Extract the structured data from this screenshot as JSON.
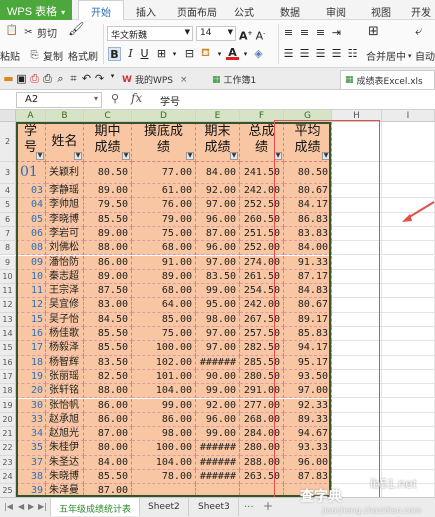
{
  "app": {
    "title": "WPS 表格"
  },
  "menu": [
    "开始",
    "插入",
    "页面布局",
    "公式",
    "数据",
    "审阅",
    "视图",
    "开发工"
  ],
  "ribbon": {
    "paste": "粘贴",
    "cut": "剪切",
    "copy": "复制",
    "format_painter": "格式刷",
    "font_name": "华文新魏",
    "font_size": "14",
    "merge_center": "合并居中",
    "auto": "自动"
  },
  "tabs": {
    "wps": "我的WPS",
    "workbook": "工作簿1",
    "file": "成绩表Excel.xls"
  },
  "formula_bar": {
    "cell_ref": "A2",
    "fx": "fx",
    "content": "学号"
  },
  "columns": [
    "A",
    "B",
    "C",
    "D",
    "E",
    "F",
    "G",
    "H",
    "I"
  ],
  "headers": {
    "a": [
      "学",
      "号"
    ],
    "b": "姓名",
    "c": [
      "期中",
      "成绩"
    ],
    "d": [
      "摸底成",
      "绩"
    ],
    "e": [
      "期末",
      "成绩"
    ],
    "f": [
      "总成",
      "绩"
    ],
    "g": [
      "平均",
      "成绩"
    ]
  },
  "row_numbers": [
    "2",
    "3",
    "4",
    "5",
    "6",
    "7",
    "8",
    "9",
    "10",
    "11",
    "12",
    "13",
    "14",
    "15",
    "16",
    "17",
    "18",
    "19",
    "20",
    "21",
    "22",
    "23",
    "24",
    "25",
    "26",
    "27",
    "28",
    "29"
  ],
  "rows": [
    {
      "id": "01",
      "name": "关颖利",
      "mid": "80.50",
      "mock": "77.00",
      "final": "84.00",
      "total": "241.50",
      "avg": "80.50"
    },
    {
      "id": "03",
      "name": "李静瑶",
      "mid": "89.00",
      "mock": "61.00",
      "final": "92.00",
      "total": "242.00",
      "avg": "80.67"
    },
    {
      "id": "04",
      "name": "李帅旭",
      "mid": "79.50",
      "mock": "76.00",
      "final": "97.00",
      "total": "252.50",
      "avg": "84.17"
    },
    {
      "id": "05",
      "name": "李晓博",
      "mid": "85.50",
      "mock": "79.00",
      "final": "96.00",
      "total": "260.50",
      "avg": "86.83"
    },
    {
      "id": "06",
      "name": "李岩可",
      "mid": "89.00",
      "mock": "75.00",
      "final": "87.00",
      "total": "251.50",
      "avg": "83.83"
    },
    {
      "id": "08",
      "name": "刘佛松",
      "mid": "88.00",
      "mock": "68.00",
      "final": "96.00",
      "total": "252.00",
      "avg": "84.00"
    },
    {
      "id": "09",
      "name": "潘怡防",
      "mid": "86.00",
      "mock": "91.00",
      "final": "97.00",
      "total": "274.00",
      "avg": "91.33"
    },
    {
      "id": "10",
      "name": "秦志超",
      "mid": "89.00",
      "mock": "89.00",
      "final": "83.50",
      "final_note": "",
      "total": "261.50",
      "avg": "87.17"
    },
    {
      "id": "11",
      "name": "王宗泽",
      "mid": "87.50",
      "mock": "68.00",
      "final": "99.00",
      "total": "254.50",
      "avg": "84.83"
    },
    {
      "id": "12",
      "name": "吴宜修",
      "mid": "83.00",
      "mock": "64.00",
      "final": "95.00",
      "total": "242.00",
      "avg": "80.67"
    },
    {
      "id": "15",
      "name": "吴子怡",
      "mid": "84.50",
      "mock": "85.00",
      "final": "98.00",
      "total": "267.50",
      "avg": "89.17"
    },
    {
      "id": "16",
      "name": "杨佳歌",
      "mid": "85.50",
      "mock": "75.00",
      "final": "97.00",
      "total": "257.50",
      "avg": "85.83"
    },
    {
      "id": "17",
      "name": "杨毅泽",
      "mid": "85.50",
      "mock": "100.00",
      "final": "97.00",
      "total": "282.50",
      "avg": "94.17"
    },
    {
      "id": "18",
      "name": "杨智辉",
      "mid": "83.50",
      "mock": "102.00",
      "final": "######",
      "total": "285.50",
      "avg": "95.17"
    },
    {
      "id": "19",
      "name": "张丽瑶",
      "mid": "82.50",
      "mock": "101.00",
      "final": "90.00",
      "total": "280.50",
      "avg": "93.50"
    },
    {
      "id": "20",
      "name": "张轩铭",
      "mid": "88.00",
      "mock": "104.00",
      "final": "99.00",
      "total": "291.00",
      "avg": "97.00"
    },
    {
      "id": "30",
      "name": "张怡帆",
      "mid": "86.00",
      "mock": "99.00",
      "final": "92.00",
      "total": "277.00",
      "avg": "92.33"
    },
    {
      "id": "33",
      "name": "赵承旭",
      "mid": "86.00",
      "mock": "86.00",
      "final": "96.00",
      "total": "268.00",
      "avg": "89.33"
    },
    {
      "id": "34",
      "name": "赵旭光",
      "mid": "87.00",
      "mock": "98.00",
      "final": "99.00",
      "total": "284.00",
      "avg": "94.67"
    },
    {
      "id": "35",
      "name": "朱桂伊",
      "mid": "80.00",
      "mock": "100.00",
      "final": "######",
      "total": "280.00",
      "avg": "93.33"
    },
    {
      "id": "37",
      "name": "朱圣达",
      "mid": "84.00",
      "mock": "104.00",
      "final": "######",
      "total": "288.00",
      "avg": "96.00"
    },
    {
      "id": "38",
      "name": "朱晓博",
      "mid": "85.50",
      "mock": "78.00",
      "final": "######",
      "total": "263.50",
      "avg": "87.83"
    },
    {
      "id": "39",
      "name": "朱泽曼",
      "mid": "87.00",
      "mock": "",
      "final": "",
      "total": "",
      "avg": ""
    }
  ],
  "row_labels_top_partial": [
    "3"
  ],
  "sheets": [
    "五年级成绩统计表",
    "Sheet2",
    "Sheet3"
  ],
  "sheet_more": "···",
  "sheet_add": "+",
  "watermark": {
    "left": "查字典",
    "right": "ib51.net",
    "mid": "教程网",
    "small": "jiaocheng.chazidian.com"
  }
}
